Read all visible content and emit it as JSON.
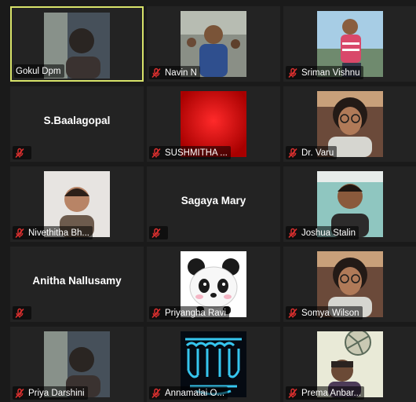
{
  "accent_active": "#d8e36a",
  "mute_color": "#e0302f",
  "participants": [
    {
      "name": "Gokul Dpm",
      "active": true,
      "muted": false,
      "video": "person-dark"
    },
    {
      "name": "Navin N",
      "muted": true,
      "video": "person-blue"
    },
    {
      "name": "Sriman Vishnu",
      "muted": true,
      "video": "person-red"
    },
    {
      "name": "",
      "display_name": "S.Baalagopal",
      "muted": true,
      "video": "none"
    },
    {
      "name": "SUSHMITHA ...",
      "muted": true,
      "video": "red-screen"
    },
    {
      "name": "Dr. Varu",
      "muted": true,
      "video": "person-glasses"
    },
    {
      "name": "Nivethitha Bh...",
      "muted": true,
      "video": "person-light"
    },
    {
      "name": "",
      "display_name": "Sagaya Mary",
      "muted": true,
      "video": "none"
    },
    {
      "name": "Joshua Stalin",
      "muted": true,
      "video": "person-teal"
    },
    {
      "name": "",
      "display_name": "Anitha Nallusamy",
      "muted": true,
      "video": "none"
    },
    {
      "name": "Priyangha Ravi",
      "muted": true,
      "video": "panda"
    },
    {
      "name": "Somya Wilson",
      "muted": true,
      "video": "person-glasses"
    },
    {
      "name": "Priya Darshini",
      "muted": true,
      "video": "person-dark"
    },
    {
      "name": "Annamalai O...",
      "muted": true,
      "video": "teeth"
    },
    {
      "name": "Prema Anbar...",
      "muted": true,
      "video": "person-fan"
    }
  ]
}
